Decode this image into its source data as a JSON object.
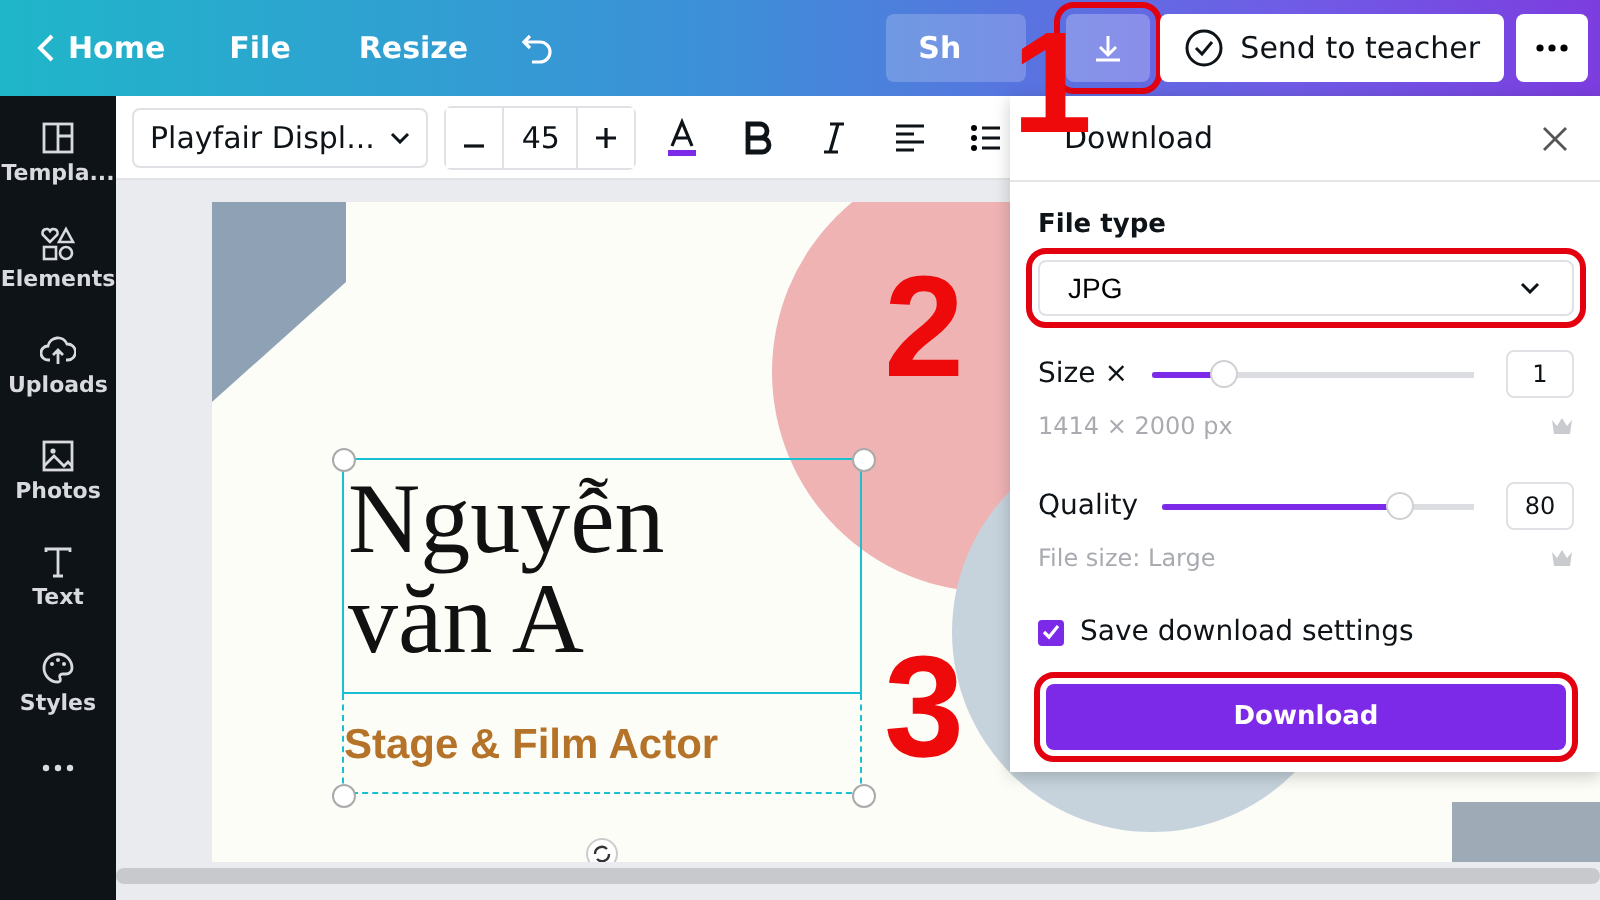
{
  "topbar": {
    "back_label": "Home",
    "menu": [
      "File",
      "Resize"
    ],
    "share_label": "Sh",
    "send_label": "Send to teacher"
  },
  "sidebar": {
    "items": [
      {
        "kind": "templates",
        "label": "Templa..."
      },
      {
        "kind": "elements",
        "label": "Elements"
      },
      {
        "kind": "uploads",
        "label": "Uploads"
      },
      {
        "kind": "photos",
        "label": "Photos"
      },
      {
        "kind": "text",
        "label": "Text"
      },
      {
        "kind": "styles",
        "label": "Styles"
      },
      {
        "kind": "more"
      }
    ]
  },
  "toolbar": {
    "font": "Playfair Displ...",
    "font_size": "45"
  },
  "design": {
    "name_lines": [
      "Nguyễn",
      "văn A"
    ],
    "subtitle": "Stage & Film Actor"
  },
  "download_panel": {
    "title": "Download",
    "file_type_label": "File type",
    "file_type": "JPG",
    "size_label": "Size ×",
    "size": {
      "level": 0.2,
      "value": "1"
    },
    "dimensions": "1414 × 2000 px",
    "quality_label": "Quality",
    "quality": {
      "level": 0.79,
      "value": "80"
    },
    "file_size": "File size: Large",
    "save_settings": {
      "label": "Save download settings",
      "checked": true
    },
    "button": "Download"
  },
  "annotations": [
    {
      "number": "1"
    },
    {
      "number": "2"
    },
    {
      "number": "3"
    }
  ]
}
